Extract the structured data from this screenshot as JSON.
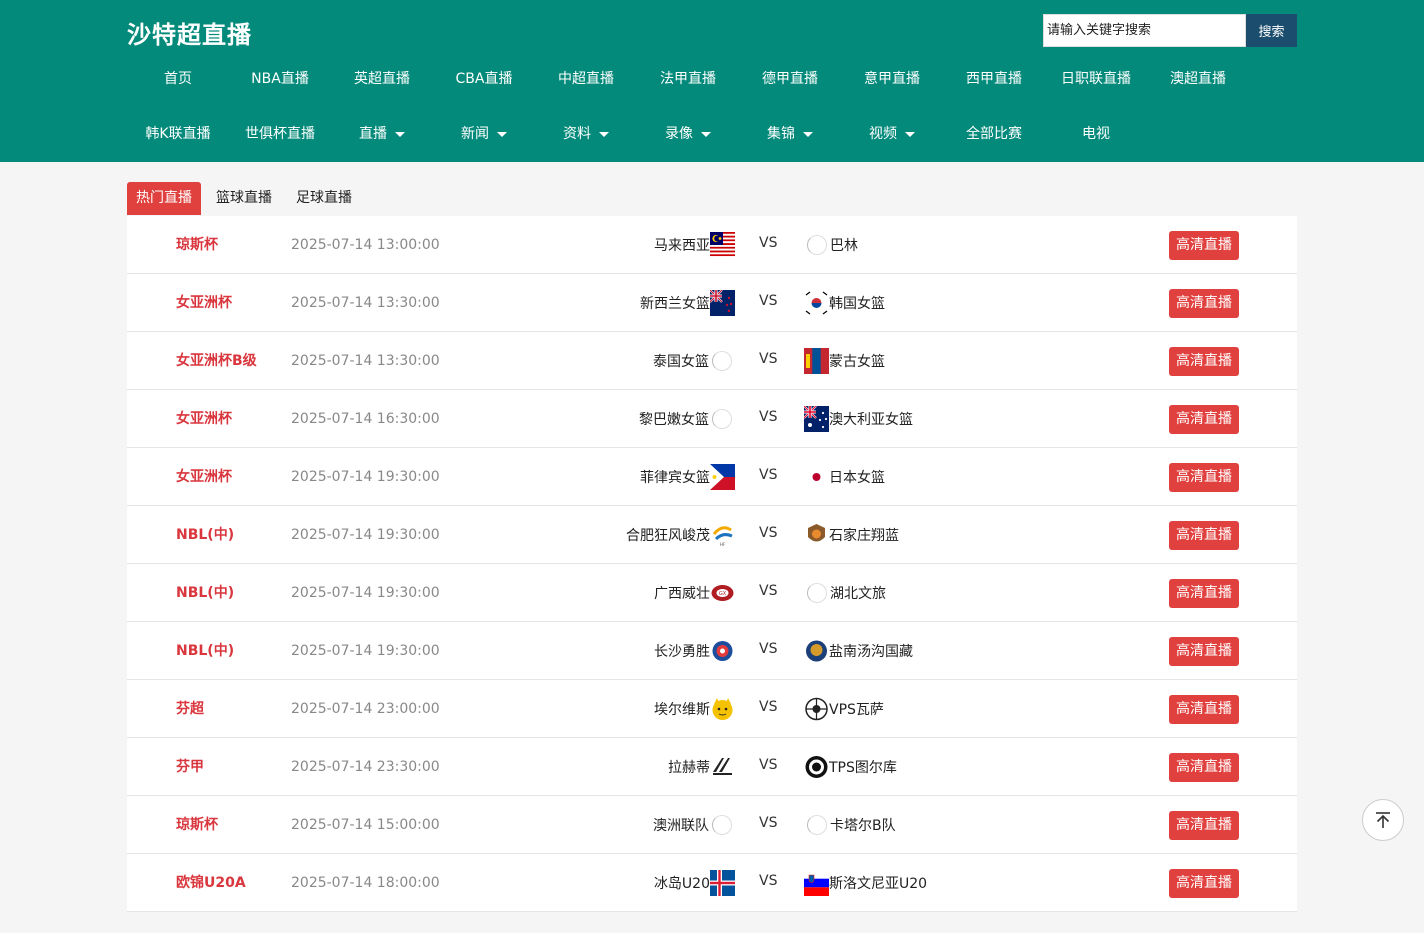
{
  "site": {
    "title": "沙特超直播"
  },
  "search": {
    "placeholder": "请输入关键字搜索",
    "button": "搜索"
  },
  "nav": {
    "row1": [
      "首页",
      "NBA直播",
      "英超直播",
      "CBA直播",
      "中超直播",
      "法甲直播",
      "德甲直播",
      "意甲直播",
      "西甲直播",
      "日职联直播",
      "澳超直播"
    ],
    "row2": [
      {
        "label": "韩K联直播",
        "dropdown": false
      },
      {
        "label": "世俱杯直播",
        "dropdown": false
      },
      {
        "label": "直播",
        "dropdown": true
      },
      {
        "label": "新闻",
        "dropdown": true
      },
      {
        "label": "资料",
        "dropdown": true
      },
      {
        "label": "录像",
        "dropdown": true
      },
      {
        "label": "集锦",
        "dropdown": true
      },
      {
        "label": "视频",
        "dropdown": true
      },
      {
        "label": "全部比赛",
        "dropdown": false
      },
      {
        "label": "电视",
        "dropdown": false
      }
    ]
  },
  "tabs": [
    {
      "label": "热门直播",
      "active": true
    },
    {
      "label": "篮球直播",
      "active": false
    },
    {
      "label": "足球直播",
      "active": false
    }
  ],
  "vs_label": "VS",
  "button_label": "高清直播",
  "matches": [
    {
      "league": "琼斯杯",
      "time": "2025-07-14 13:00:00",
      "home": "马来西亚",
      "home_icon": "flag-malaysia",
      "away": "巴林",
      "away_icon": "logo-placeholder"
    },
    {
      "league": "女亚洲杯",
      "time": "2025-07-14 13:30:00",
      "home": "新西兰女篮",
      "home_icon": "flag-new-zealand",
      "away": "韩国女篮",
      "away_icon": "flag-korea"
    },
    {
      "league": "女亚洲杯B级",
      "time": "2025-07-14 13:30:00",
      "home": "泰国女篮",
      "home_icon": "logo-placeholder",
      "away": "蒙古女篮",
      "away_icon": "flag-mongolia"
    },
    {
      "league": "女亚洲杯",
      "time": "2025-07-14 16:30:00",
      "home": "黎巴嫩女篮",
      "home_icon": "logo-placeholder",
      "away": "澳大利亚女篮",
      "away_icon": "flag-australia"
    },
    {
      "league": "女亚洲杯",
      "time": "2025-07-14 19:30:00",
      "home": "菲律宾女篮",
      "home_icon": "flag-philippines",
      "away": "日本女篮",
      "away_icon": "flag-japan"
    },
    {
      "league": "NBL(中)",
      "time": "2025-07-14 19:30:00",
      "home": "合肥狂风峻茂",
      "home_icon": "team-logo-hefei",
      "away": "石家庄翔蓝",
      "away_icon": "team-logo-shijiazhuang"
    },
    {
      "league": "NBL(中)",
      "time": "2025-07-14 19:30:00",
      "home": "广西威壮",
      "home_icon": "team-logo-guangxi",
      "away": "湖北文旅",
      "away_icon": "logo-placeholder"
    },
    {
      "league": "NBL(中)",
      "time": "2025-07-14 19:30:00",
      "home": "长沙勇胜",
      "home_icon": "team-logo-changsha",
      "away": "盐南汤沟国藏",
      "away_icon": "team-logo-yannan"
    },
    {
      "league": "芬超",
      "time": "2025-07-14 23:00:00",
      "home": "埃尔维斯",
      "home_icon": "team-logo-ilves",
      "away": "VPS瓦萨",
      "away_icon": "team-logo-vps"
    },
    {
      "league": "芬甲",
      "time": "2025-07-14 23:30:00",
      "home": "拉赫蒂",
      "home_icon": "team-logo-lahti",
      "away": "TPS图尔库",
      "away_icon": "team-logo-tps"
    },
    {
      "league": "琼斯杯",
      "time": "2025-07-14 15:00:00",
      "home": "澳洲联队",
      "home_icon": "logo-placeholder",
      "away": "卡塔尔B队",
      "away_icon": "logo-placeholder"
    },
    {
      "league": "欧锦U20A",
      "time": "2025-07-14 18:00:00",
      "home": "冰岛U20",
      "home_icon": "flag-iceland",
      "away": "斯洛文尼亚U20",
      "away_icon": "flag-slovenia"
    }
  ],
  "colors": {
    "header": "#038a7a",
    "accent": "#e0413f",
    "league_text": "#d9363e",
    "search_button": "#1b4d6e"
  },
  "back_to_top_icon": "arrow-up-icon"
}
